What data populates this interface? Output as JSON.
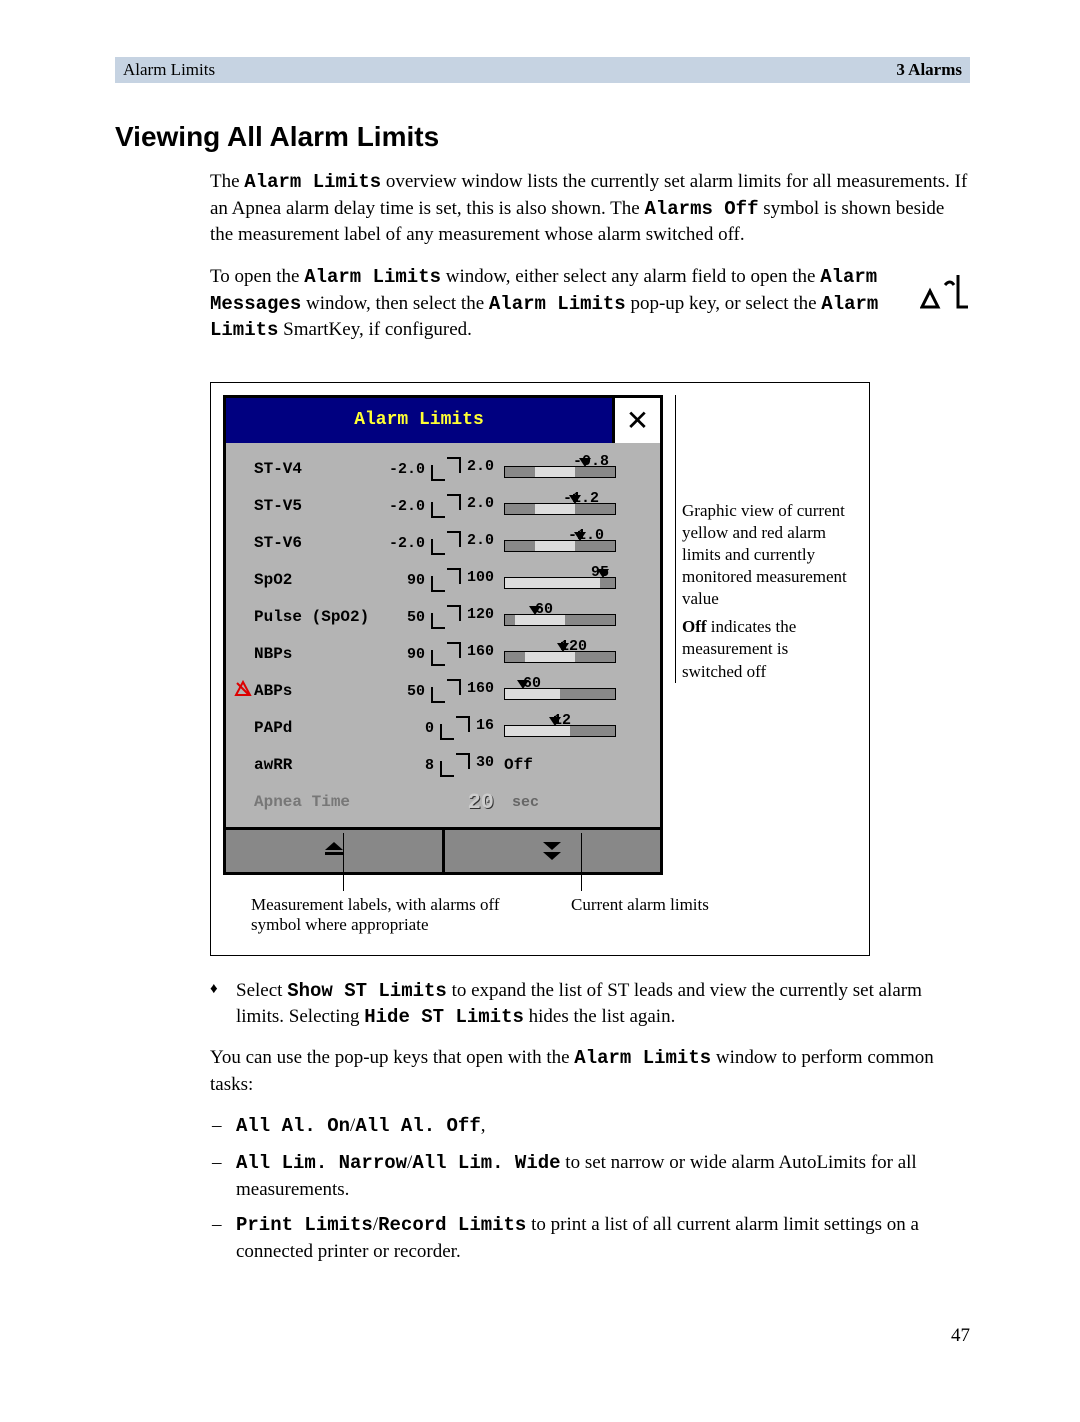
{
  "header": {
    "left": "Alarm Limits",
    "right": "3 Alarms"
  },
  "h1": "Viewing All Alarm Limits",
  "para1": {
    "pre1": "The ",
    "mono1": "Alarm Limits",
    "mid1": " overview window lists the currently set alarm limits for all measurements. If an Apnea alarm delay time is set, this is also shown. The ",
    "mono2": "Alarms Off",
    "post1": " symbol is shown beside the measurement label of any measurement whose alarm switched off."
  },
  "para2": {
    "pre": "To open the ",
    "m1": "Alarm Limits",
    "mid1": " window, either select any alarm field to open the ",
    "m2": "Alarm Messages",
    "mid2": " window, then select the ",
    "m3": "Alarm Limits",
    "mid3": " pop-up key, or select the ",
    "m4": "Alarm Limits",
    "post": " SmartKey, if configured."
  },
  "window": {
    "title": "Alarm Limits",
    "rows": [
      {
        "label": "ST-V4",
        "lo": "-2.0",
        "hi": "2.0",
        "val": "-0.8",
        "band_l": 30,
        "band_w": 40,
        "marker_l": 80,
        "val_l": 68
      },
      {
        "label": "ST-V5",
        "lo": "-2.0",
        "hi": "2.0",
        "val": "-1.2",
        "band_l": 30,
        "band_w": 40,
        "marker_l": 70,
        "val_l": 58
      },
      {
        "label": "ST-V6",
        "lo": "-2.0",
        "hi": "2.0",
        "val": "-1.0",
        "band_l": 30,
        "band_w": 40,
        "marker_l": 75,
        "val_l": 63
      },
      {
        "label": "SpO2",
        "lo": "90",
        "hi": "100",
        "val": "95",
        "band_l": 0,
        "band_w": 95,
        "marker_l": 98,
        "val_l": 86
      },
      {
        "label": "Pulse (SpO2)",
        "lo": "50",
        "hi": "120",
        "val": "60",
        "band_l": 10,
        "band_w": 50,
        "marker_l": 30,
        "val_l": 30
      },
      {
        "label": "NBPs",
        "lo": "90",
        "hi": "160",
        "val": "120",
        "band_l": 20,
        "band_w": 50,
        "marker_l": 58,
        "val_l": 55
      },
      {
        "label": "ABPs",
        "lo": "50",
        "hi": "160",
        "val": "60",
        "band_l": 0,
        "band_w": 55,
        "marker_l": 18,
        "val_l": 18,
        "off_icon": true
      },
      {
        "label": "PAPd",
        "lo": "0",
        "hi": "16",
        "val": "12",
        "band_l": 0,
        "band_w": 65,
        "marker_l": 50,
        "val_l": 48
      },
      {
        "label": "awRR",
        "lo": "8",
        "hi": "30",
        "off_text": "Off"
      }
    ],
    "apnea": {
      "label": "Apnea Time",
      "value": "20",
      "unit": "sec"
    }
  },
  "side_annot": {
    "p1": "Graphic view of current yellow and red alarm limits and currently monitored measurement value",
    "p2a": "Off",
    "p2b": " indicates the measurement is switched off"
  },
  "bottom_annot": {
    "a1": "Measurement labels, with alarms off symbol where appropriate",
    "a2": "Current alarm limits"
  },
  "bullet": {
    "pre": "Select ",
    "m1": "Show ST Limits",
    "mid": " to expand the list of ST leads and view the currently set alarm limits. Selecting ",
    "m2": "Hide ST Limits",
    "post": " hides the list again."
  },
  "para3": {
    "pre": "You can use the pop-up keys that open with the ",
    "m1": "Alarm Limits",
    "post": " window to perform common tasks:"
  },
  "dash": {
    "d1a": "All Al. On",
    "d1slash": "/",
    "d1b": "All Al. Off",
    "d1post": ",",
    "d2a": "All Lim. Narrow",
    "d2slash": "/",
    "d2b": "All Lim. Wide",
    "d2post": " to set narrow or wide alarm AutoLimits for all measurements.",
    "d3a": "Print Limits",
    "d3slash": "/",
    "d3b": "Record Limits",
    "d3post": " to print a list of all current alarm limit settings on a connected printer or recorder."
  },
  "page_number": "47"
}
